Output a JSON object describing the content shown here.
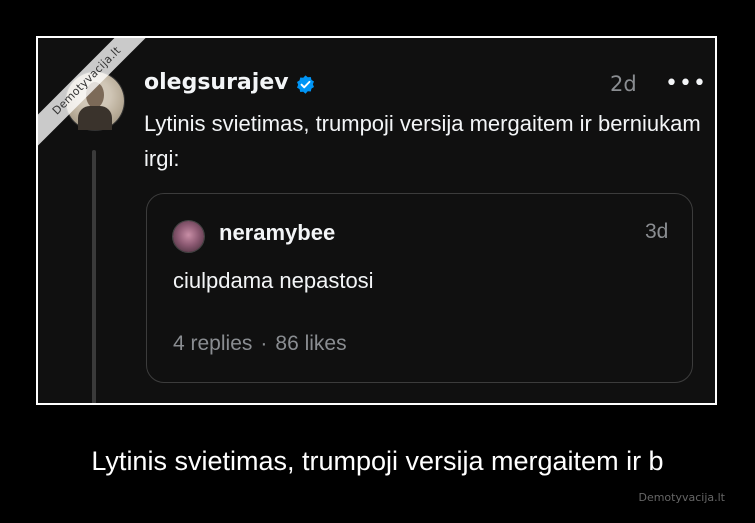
{
  "watermark": "Demotyvacija.lt",
  "post": {
    "username": "olegsurajev",
    "verified": true,
    "time": "2d",
    "more_icon": "•••",
    "text": "Lytinis svietimas, trumpoji versija mergaitem ir berniukam irgi:"
  },
  "quoted_post": {
    "username": "neramybee",
    "time": "3d",
    "text": "ciulpdama nepastosi",
    "replies": "4 replies",
    "separator": "·",
    "likes": "86 likes"
  },
  "caption": "Lytinis svietimas, trumpoji versija mergaitem ir b",
  "site": "Demotyvacija.lt",
  "colors": {
    "background": "#000000",
    "card": "#101010",
    "verified_blue": "#0095f6",
    "muted": "#8a8d91"
  }
}
